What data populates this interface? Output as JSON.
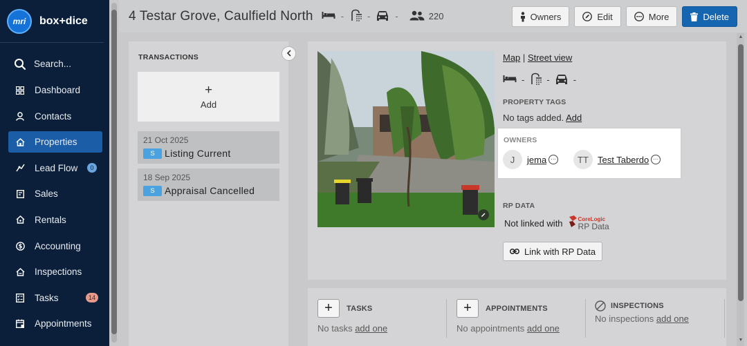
{
  "sidebar": {
    "brand_logo": "mri",
    "brand_name": "box+dice",
    "items": [
      {
        "label": "Search...",
        "icon": "search-icon"
      },
      {
        "label": "Dashboard",
        "icon": "dashboard-icon"
      },
      {
        "label": "Contacts",
        "icon": "contacts-icon"
      },
      {
        "label": "Properties",
        "icon": "home-icon",
        "active": true
      },
      {
        "label": "Lead Flow",
        "icon": "lead-flow-icon",
        "badge": "0"
      },
      {
        "label": "Sales",
        "icon": "sales-icon"
      },
      {
        "label": "Rentals",
        "icon": "rentals-icon"
      },
      {
        "label": "Accounting",
        "icon": "dollar-icon"
      },
      {
        "label": "Inspections",
        "icon": "inspections-icon"
      },
      {
        "label": "Tasks",
        "icon": "tasks-icon",
        "badge": "14"
      },
      {
        "label": "Appointments",
        "icon": "calendar-icon"
      }
    ]
  },
  "header": {
    "title": "4 Testar Grove, Caulfield North",
    "beds": "-",
    "baths": "-",
    "cars": "-",
    "people_count": "220",
    "buttons": {
      "owners": "Owners",
      "edit": "Edit",
      "more": "More",
      "delete": "Delete"
    }
  },
  "transactions": {
    "heading": "TRANSACTIONS",
    "add_label": "Add",
    "items": [
      {
        "date": "21 Oct 2025",
        "tag": "S",
        "status": "Listing Current"
      },
      {
        "date": "18 Sep 2025",
        "tag": "S",
        "status": "Appraisal Cancelled"
      }
    ]
  },
  "property": {
    "map_link": "Map",
    "separator": "|",
    "street_view_link": "Street view",
    "beds": "-",
    "baths": "-",
    "cars": "-",
    "tags_heading": "PROPERTY TAGS",
    "tags_text": "No tags added.",
    "tags_add": "Add",
    "owners_heading": "OWNERS",
    "owners": [
      {
        "initials": "J",
        "name": "jema"
      },
      {
        "initials": "TT",
        "name": "Test Taberdo"
      }
    ],
    "rp_heading": "RP DATA",
    "rp_status": "Not linked with",
    "rp_brand": "CoreLogic",
    "rp_brand_sub": "RP Data",
    "rp_button": "Link with RP Data"
  },
  "bottom": {
    "tasks": {
      "label": "TASKS",
      "empty": "No tasks",
      "add": "add one"
    },
    "appointments": {
      "label": "APPOINTMENTS",
      "empty": "No appointments",
      "add": "add one"
    },
    "inspections": {
      "label": "INSPECTIONS",
      "empty": "No inspections",
      "add": "add one"
    }
  },
  "colors": {
    "sidebar_bg": "#0b1f3a",
    "active_nav": "#1c5da8",
    "delete_button": "#1565b0",
    "status_tag": "#4aa2e0"
  }
}
